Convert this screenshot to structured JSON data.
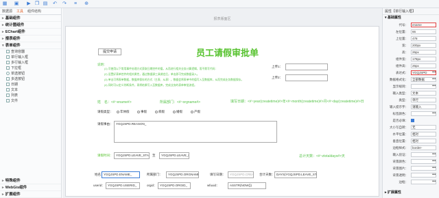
{
  "toolbar": {
    "icons": [
      "grid-icon",
      "save-icon",
      "play-icon",
      "copy-icon",
      "paste-icon",
      "undo-icon",
      "redo-icon",
      "align-icon",
      "zoom-icon"
    ]
  },
  "left": {
    "tabs": [
      "数据源",
      "工具",
      "组件结构"
    ],
    "groups": {
      "basic": "基础组件",
      "stats": "统计图组件",
      "echart": "EChart组件",
      "report": "报表组件",
      "form": "表单组件",
      "special": "特殊组件",
      "webgis": "WebGis组件",
      "ext": "扩展组件"
    },
    "form_items": [
      "查询容器",
      "单行输入框",
      "多行输入框",
      "下拉框",
      "单选按钮",
      "多选按钮",
      "日期",
      "文本",
      "列表",
      "文件"
    ]
  },
  "canvas": {
    "title": "报表版面区",
    "submit": "提交申请",
    "heading": "员工请假审批单",
    "note_label": "说明：",
    "notes": [
      "(1) 可使用以下常用事件处理方式获取日期控件的值，从而进行相关业务计算逻辑，而不需写代码：",
      "(2) 设置好表单控件的相关属性，通过数据源工具绑定后，单击即可完成数据录入。",
      "(3) 单击可将表单数据，数据库保存的方式（主表、从表），数据会将表单中的值写入至数据库，从而完成业务数据保存。",
      "(4) 同时可以定义判断条件，再将结果写入至数据库，完成业务的表单审批流程。"
    ],
    "upload1": "上传1：",
    "upload2": "上传2：",
    "name_line": "姓　名：<#~ename#>",
    "dept_line": "所属部门：<#~orgname#>",
    "date_line": "填写日期：<#~year(createtime)#>年<#~month(createtime)#>月<#~day(createtime)#>日",
    "leave_type_label": "请假类型：",
    "leave_types": [
      "年休假",
      "事假",
      "病假",
      "婚假",
      "产假"
    ],
    "reason_label": "请假事由：",
    "reason_value": "YGQJSPD.REASON_",
    "time_label": "请假时间：",
    "time_start": "YGQJSPD.LEAVE_STA",
    "time_sep": "至",
    "time_end": "YGQJSPD.LEAVE_EN",
    "days_line": "总计天数：<#~ztotaldays#>天",
    "row1": {
      "l1": "姓名：",
      "v1": "YGQJSPD.ENAME_",
      "l2": "所属部门：",
      "v2": "YGQJSPD.ORGNAME_",
      "l3": "填写日期：",
      "v3": "YGQJSPD.CREATET",
      "l4": "合计天数：",
      "v4": "DAYS(YGQJSPD.LEAVE_ST"
    },
    "row2": {
      "l1": "userid：",
      "v1": "YGQJSPD.USERID_",
      "l2": "orgid：",
      "v2": "YGQJSPD.ORGID_",
      "l3": "wfuuid：",
      "v3": "ASSTR(NOW())"
    }
  },
  "right": {
    "header": "属性【单行输入框】",
    "sec_basic": "基础属性",
    "props": [
      {
        "label": "代号：",
        "value": "ename",
        "hl": true
      },
      {
        "label": "左位置：",
        "value": "66"
      },
      {
        "label": "上位置：",
        "value": "478"
      },
      {
        "label": "宽：",
        "value": "200px"
      },
      {
        "label": "高：",
        "value": "26px"
      },
      {
        "label": "组件宽：",
        "value": "178px"
      },
      {
        "label": "组件高：",
        "value": "26px"
      },
      {
        "label": "表达式：",
        "value": "YGQJSPD",
        "hl": true,
        "dots": true
      },
      {
        "label": "数据格式化：",
        "value": "全部数据",
        "dots": true
      },
      {
        "label": "显示规则：",
        "value": "",
        "dots": true
      },
      {
        "label": "输入类型：",
        "value": "文本"
      },
      {
        "label": "类型：",
        "value": "单行"
      },
      {
        "label": "输入提示字：",
        "value": "请输入"
      },
      {
        "label": "标签颜色：",
        "value": "",
        "dots": true
      },
      {
        "label": "是否必填：",
        "value": "",
        "check": true
      },
      {
        "label": "大小写自转：",
        "value": "无"
      },
      {
        "label": "水平位置：",
        "value": "相对"
      },
      {
        "label": "垂直位置：",
        "value": "相对"
      },
      {
        "label": "边框样式：",
        "value": "border-"
      },
      {
        "label": "输入验证：",
        "value": "",
        "dots": true
      },
      {
        "label": "背景颜色：",
        "value": "",
        "dots": true
      },
      {
        "label": "背景图片：",
        "value": "",
        "dots": true
      },
      {
        "label": "背景透明：",
        "value": "",
        "dots": true
      },
      {
        "label": "边框：",
        "value": "",
        "dots": true
      }
    ],
    "sec_event": "扩展属性"
  }
}
